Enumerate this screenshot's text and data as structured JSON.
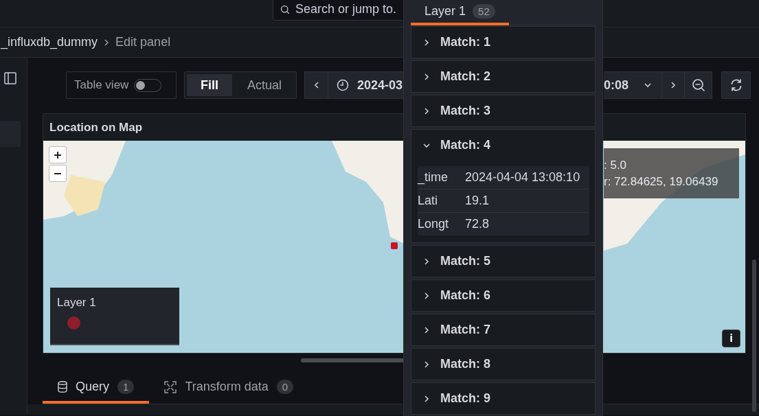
{
  "search": {
    "placeholder": "Search or jump to."
  },
  "breadcrumb": [
    {
      "label": "_influxdb_dummy"
    },
    {
      "label": "Edit panel"
    }
  ],
  "toolbar": {
    "table_view": {
      "label": "Table view",
      "on": false
    },
    "view_modes": [
      {
        "label": "Fill",
        "selected": true
      },
      {
        "label": "Actual",
        "selected": false
      }
    ],
    "time_range": {
      "start": "2024-03",
      "end": "0:08"
    }
  },
  "panel": {
    "title": "Location on Map",
    "tooltip": {
      "lines": [
        ": 5.0",
        "r: 72.84625, 19.06439"
      ]
    },
    "legend": {
      "title": "Layer 1"
    },
    "info_button": "i"
  },
  "tabs": [
    {
      "label": "Query",
      "count": "1",
      "selected": true,
      "kind": "database"
    },
    {
      "label": "Transform data",
      "count": "0",
      "selected": false,
      "kind": "transform"
    }
  ],
  "popup": {
    "tab": {
      "label": "Layer 1",
      "count": "52",
      "selected": true
    },
    "matches": [
      {
        "label": "Match: 1",
        "expanded": false
      },
      {
        "label": "Match: 2",
        "expanded": false
      },
      {
        "label": "Match: 3",
        "expanded": false
      },
      {
        "label": "Match: 4",
        "expanded": true,
        "fields": [
          {
            "name": "_time",
            "value": "2024-04-04 13:08:10"
          },
          {
            "name": "Lati",
            "value": "19.1"
          },
          {
            "name": "Longt",
            "value": "72.8"
          }
        ]
      },
      {
        "label": "Match: 5",
        "expanded": false
      },
      {
        "label": "Match: 6",
        "expanded": false
      },
      {
        "label": "Match: 7",
        "expanded": false
      },
      {
        "label": "Match: 8",
        "expanded": false
      },
      {
        "label": "Match: 9",
        "expanded": false
      }
    ]
  }
}
